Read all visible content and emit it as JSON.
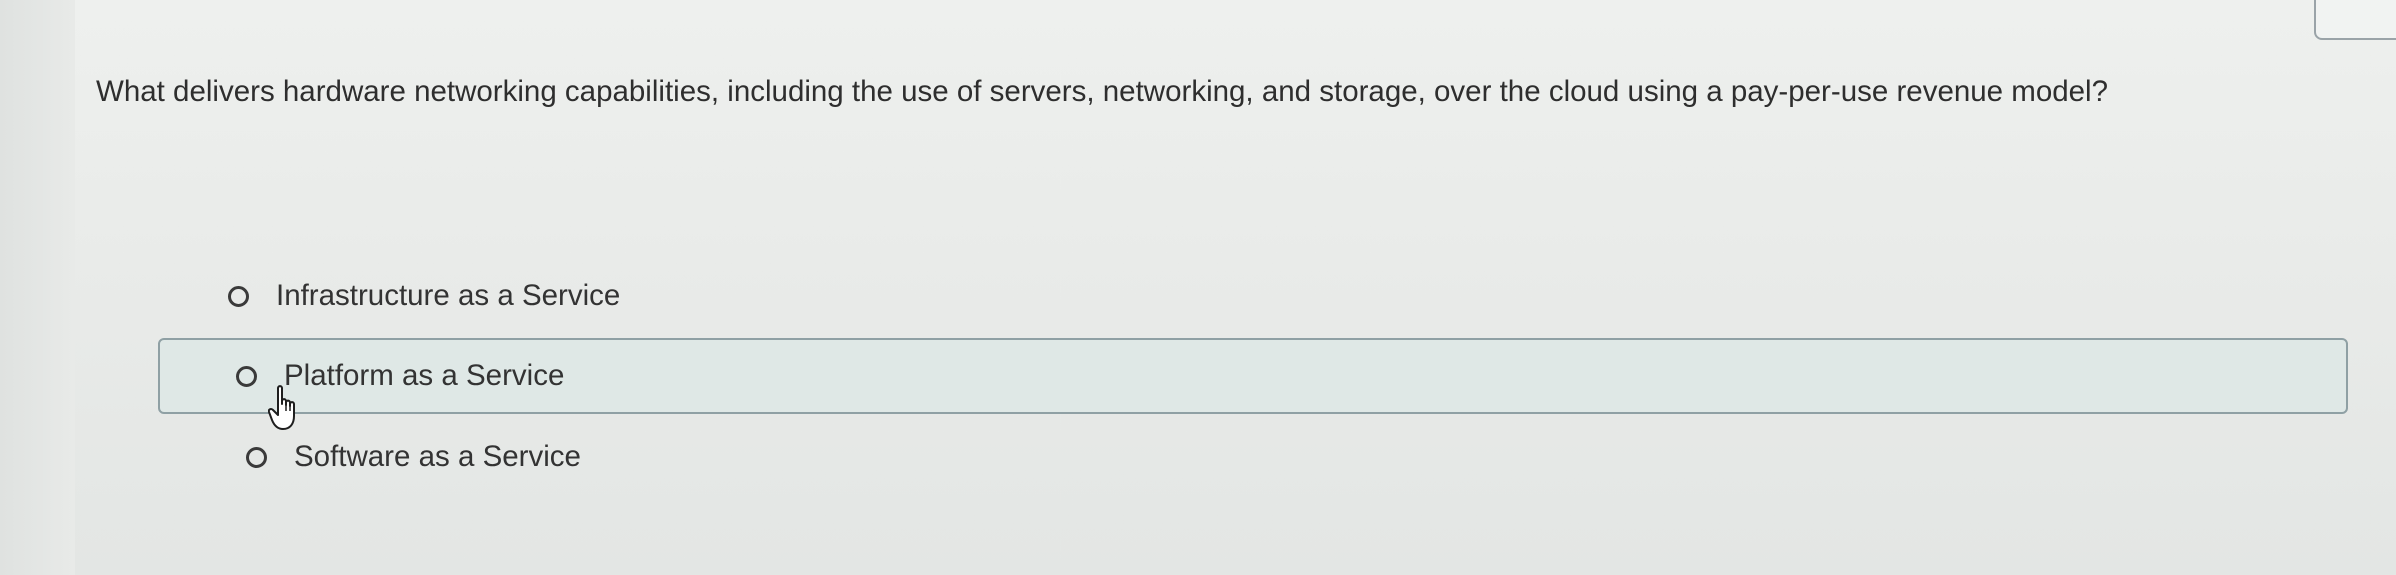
{
  "question": {
    "text": "What delivers hardware networking capabilities, including the use of servers, networking, and storage, over the cloud using a pay-per-use revenue model?"
  },
  "options": [
    {
      "label": "Infrastructure as a Service",
      "selected": false
    },
    {
      "label": "Platform as a Service",
      "selected": false,
      "hovered": true
    },
    {
      "label": "Software as a Service",
      "selected": false
    }
  ],
  "colors": {
    "hover_background": "#dfe8e6",
    "hover_border": "#8fa0a4",
    "text": "#2e2e2e"
  },
  "icons": {
    "cursor": "hand-pointer-icon",
    "radio": "radio-unchecked-icon"
  }
}
